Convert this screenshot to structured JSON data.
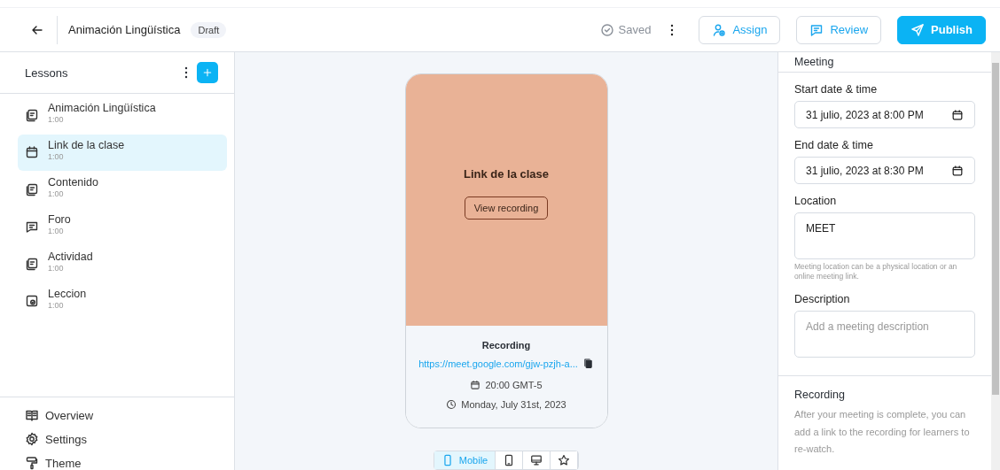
{
  "header": {
    "title": "Animación Lingüística",
    "badge": "Draft",
    "status": "Saved",
    "buttons": [
      {
        "label": "Assign",
        "kind": "assign"
      },
      {
        "label": "Review",
        "kind": "review"
      },
      {
        "label": "Publish",
        "kind": "publish"
      }
    ]
  },
  "sidebar": {
    "title": "Lessons",
    "items": [
      {
        "title": "Animación Lingüística",
        "duration": "1:00",
        "kind": "page",
        "selected": false
      },
      {
        "title": "Link de la clase",
        "duration": "1:00",
        "kind": "meeting",
        "selected": true
      },
      {
        "title": "Contenido",
        "duration": "1:00",
        "kind": "page",
        "selected": false
      },
      {
        "title": "Foro",
        "duration": "1:00",
        "kind": "forum",
        "selected": false
      },
      {
        "title": "Actividad",
        "duration": "1:00",
        "kind": "page",
        "selected": false
      },
      {
        "title": "Leccion",
        "duration": "1:00",
        "kind": "quiz",
        "selected": false
      }
    ],
    "footer": [
      {
        "label": "Overview",
        "kind": "overview"
      },
      {
        "label": "Settings",
        "kind": "settings"
      },
      {
        "label": "Theme",
        "kind": "theme"
      }
    ]
  },
  "preview": {
    "title": "Link de la clase",
    "button": "View recording",
    "recording_label": "Recording",
    "link": "https://meet.google.com/gjw-pzjh-a...",
    "time": "20:00 GMT-5",
    "date": "Monday, July 31st, 2023",
    "devices": [
      {
        "label": "Mobile",
        "kind": "mobile",
        "selected": true
      },
      {
        "kind": "tablet",
        "selected": false
      },
      {
        "kind": "desktop",
        "selected": false
      },
      {
        "kind": "star",
        "selected": false
      }
    ]
  },
  "panel": {
    "title": "Meeting",
    "fields": [
      {
        "label": "Start date & time",
        "value": "31 julio, 2023 at 8:00 PM",
        "kind": "date"
      },
      {
        "label": "End date & time",
        "value": "31 julio, 2023 at 8:30 PM",
        "kind": "date"
      },
      {
        "label": "Location",
        "value": "MEET",
        "kind": "textarea",
        "help": "Meeting location can be a physical location or an online meeting link."
      },
      {
        "label": "Description",
        "placeholder": "Add a meeting description",
        "kind": "textarea"
      }
    ],
    "recording": {
      "title": "Recording",
      "text": "After your meeting is complete, you can add a link to the recording for learners to re-watch."
    }
  }
}
